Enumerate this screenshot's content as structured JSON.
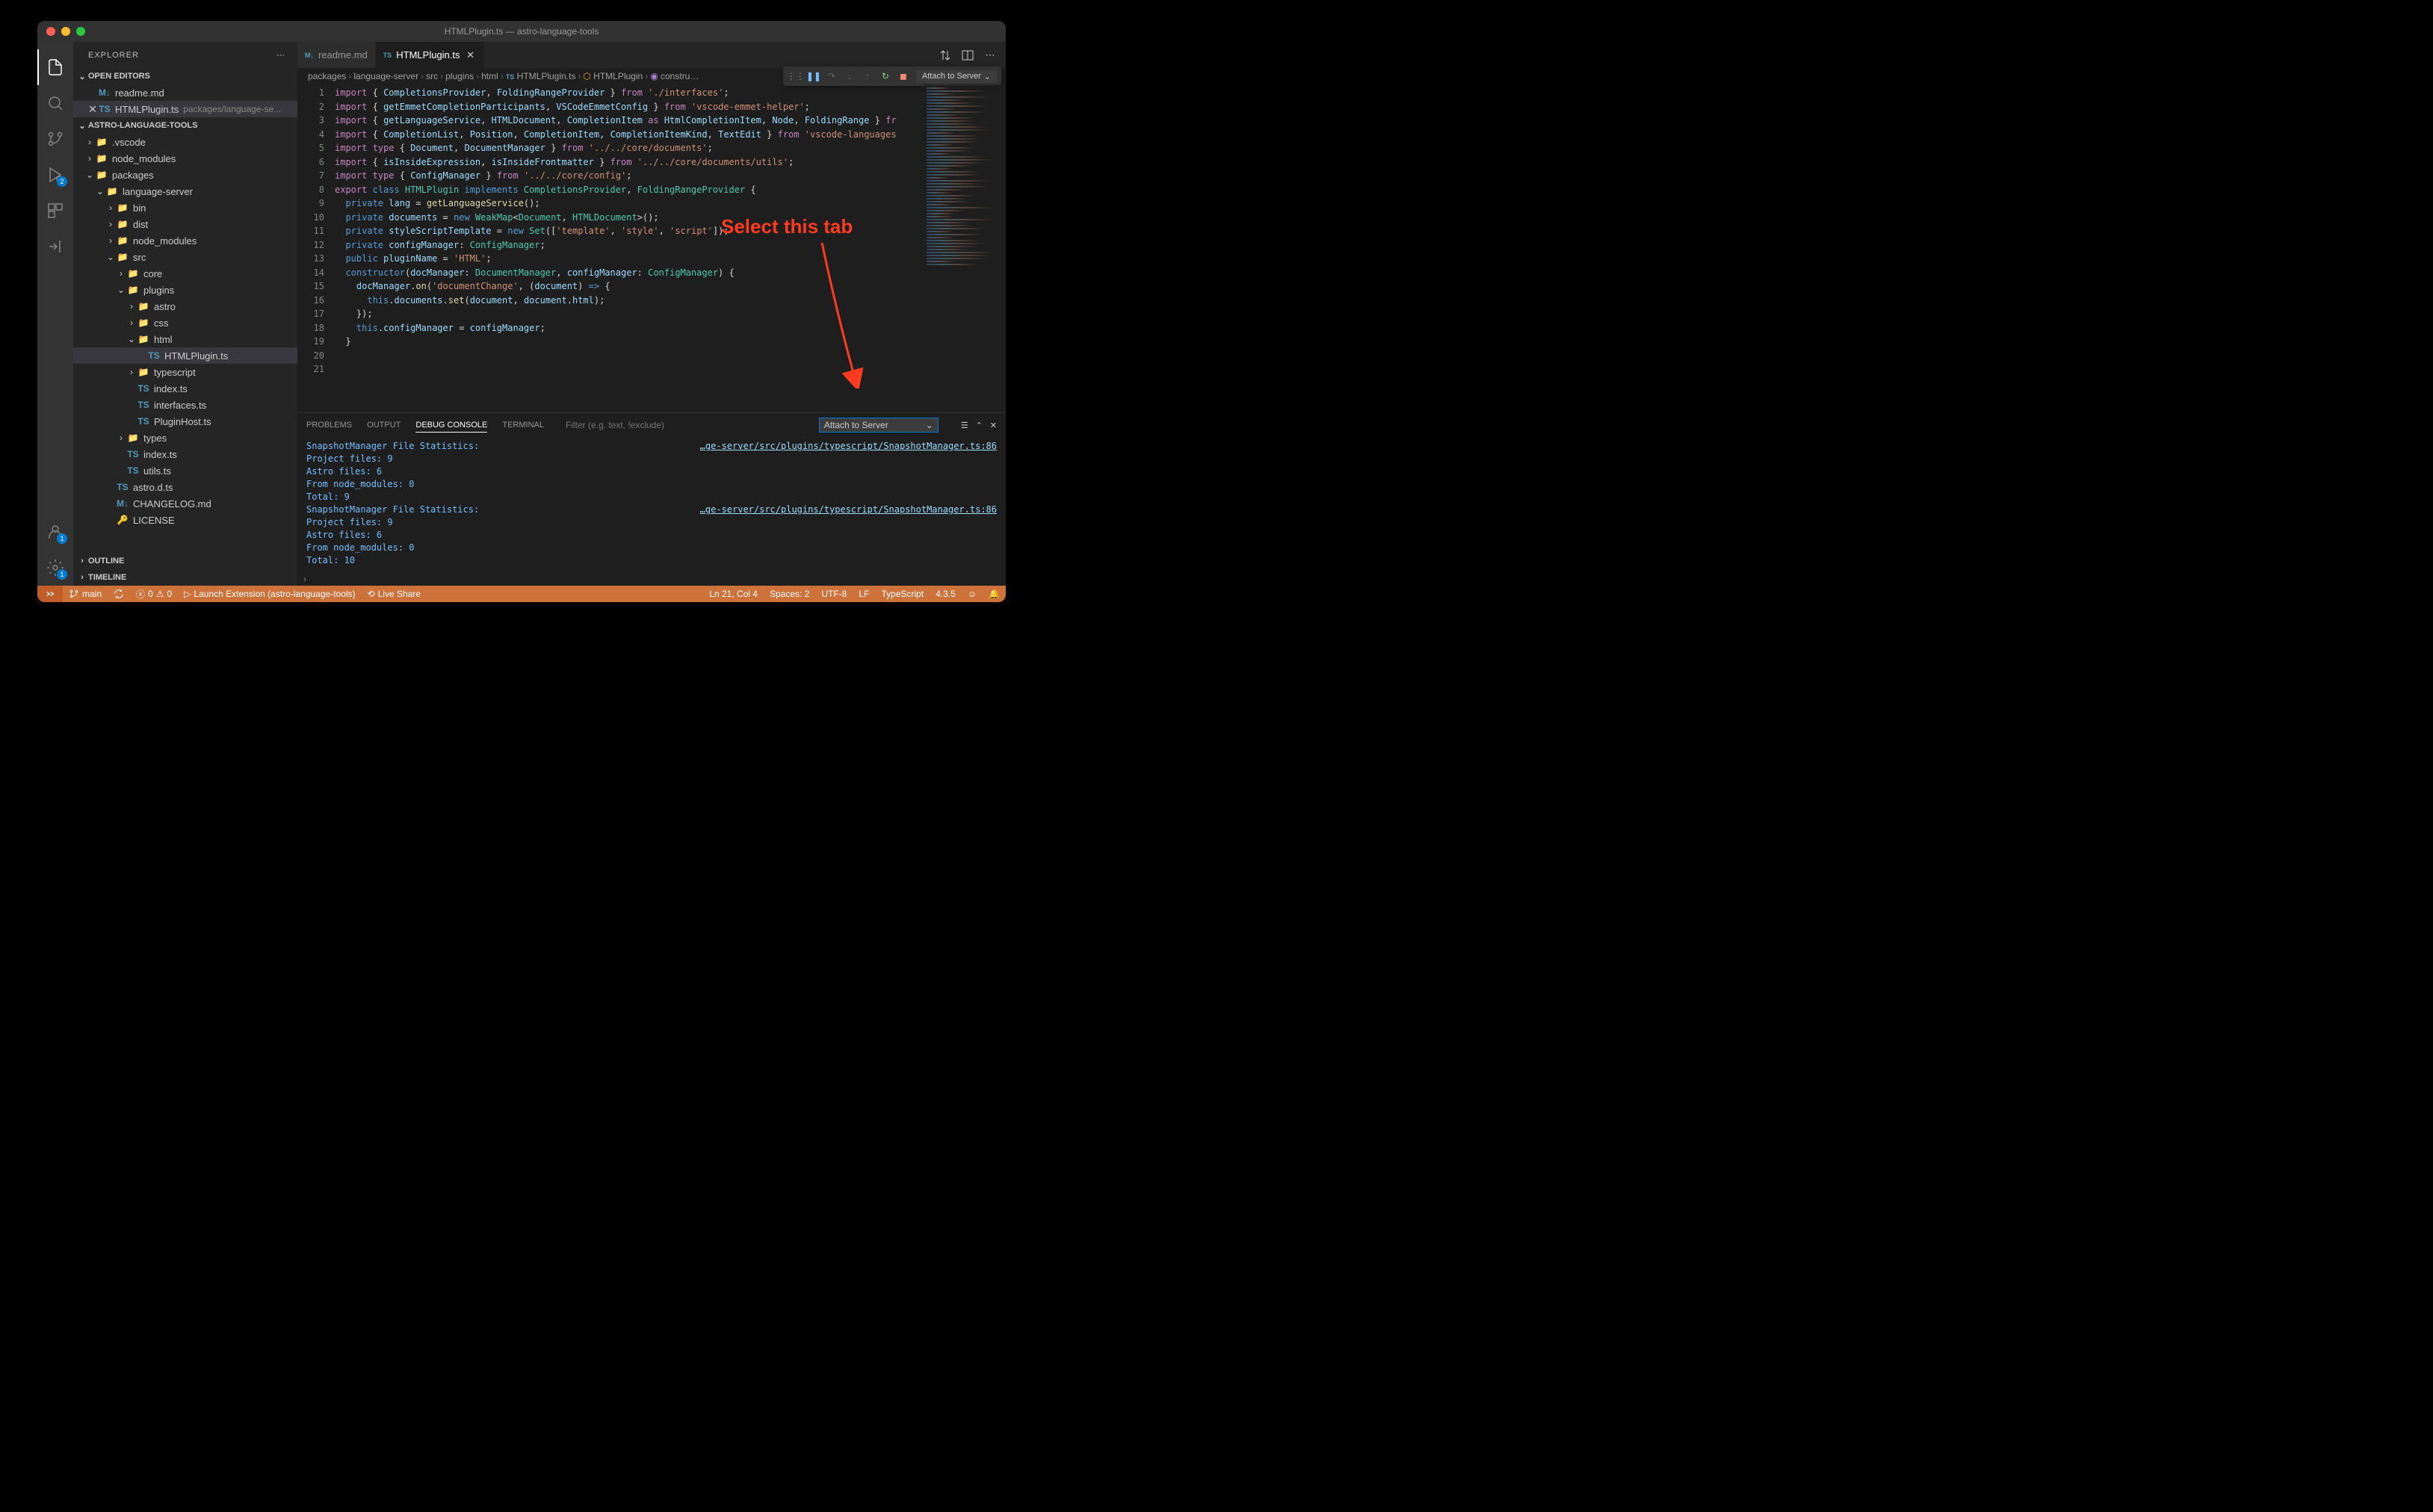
{
  "window": {
    "title": "HTMLPlugin.ts — astro-language-tools"
  },
  "sidebar": {
    "title": "EXPLORER",
    "sections": {
      "openEditors": "OPEN EDITORS",
      "workspace": "ASTRO-LANGUAGE-TOOLS",
      "outline": "OUTLINE",
      "timeline": "TIMELINE"
    },
    "openEditorItems": [
      {
        "icon": "M↓",
        "label": "readme.md",
        "closable": false
      },
      {
        "icon": "TS",
        "label": "HTMLPlugin.ts",
        "dim": "packages/language-se...",
        "closable": true,
        "selected": true
      }
    ],
    "tree": [
      {
        "d": 0,
        "chev": "›",
        "icon": "📁",
        "cls": "folder-blue",
        "label": ".vscode"
      },
      {
        "d": 0,
        "chev": "›",
        "icon": "📁",
        "cls": "folder-green",
        "label": "node_modules"
      },
      {
        "d": 0,
        "chev": "⌄",
        "icon": "📁",
        "cls": "folder-yellow",
        "label": "packages"
      },
      {
        "d": 1,
        "chev": "⌄",
        "icon": "📁",
        "cls": "folder-yellow",
        "label": "language-server"
      },
      {
        "d": 2,
        "chev": "›",
        "icon": "📁",
        "cls": "folder-red",
        "label": "bin"
      },
      {
        "d": 2,
        "chev": "›",
        "icon": "📁",
        "cls": "folder-yellow",
        "label": "dist"
      },
      {
        "d": 2,
        "chev": "›",
        "icon": "📁",
        "cls": "folder-green",
        "label": "node_modules"
      },
      {
        "d": 2,
        "chev": "⌄",
        "icon": "📁",
        "cls": "folder-green",
        "label": "src"
      },
      {
        "d": 3,
        "chev": "›",
        "icon": "📁",
        "cls": "folder-yellow",
        "label": "core"
      },
      {
        "d": 3,
        "chev": "⌄",
        "icon": "📁",
        "cls": "folder-red",
        "label": "plugins"
      },
      {
        "d": 4,
        "chev": "›",
        "icon": "📁",
        "cls": "folder-yellow",
        "label": "astro"
      },
      {
        "d": 4,
        "chev": "›",
        "icon": "📁",
        "cls": "folder-blue",
        "label": "css"
      },
      {
        "d": 4,
        "chev": "⌄",
        "icon": "📁",
        "cls": "folder-red",
        "label": "html"
      },
      {
        "d": 5,
        "chev": "",
        "icon": "TS",
        "cls": "file-ts",
        "label": "HTMLPlugin.ts",
        "selected": true
      },
      {
        "d": 4,
        "chev": "›",
        "icon": "📁",
        "cls": "folder-blue",
        "label": "typescript"
      },
      {
        "d": 4,
        "chev": "",
        "icon": "TS",
        "cls": "file-ts",
        "label": "index.ts"
      },
      {
        "d": 4,
        "chev": "",
        "icon": "TS",
        "cls": "file-ts",
        "label": "interfaces.ts"
      },
      {
        "d": 4,
        "chev": "",
        "icon": "TS",
        "cls": "file-ts",
        "label": "PluginHost.ts"
      },
      {
        "d": 3,
        "chev": "›",
        "icon": "📁",
        "cls": "folder-yellow",
        "label": "types"
      },
      {
        "d": 3,
        "chev": "",
        "icon": "TS",
        "cls": "file-ts",
        "label": "index.ts"
      },
      {
        "d": 3,
        "chev": "",
        "icon": "TS",
        "cls": "file-ts",
        "label": "utils.ts"
      },
      {
        "d": 2,
        "chev": "",
        "icon": "TS",
        "cls": "file-ts",
        "label": "astro.d.ts"
      },
      {
        "d": 2,
        "chev": "",
        "icon": "M↓",
        "cls": "file-md",
        "label": "CHANGELOG.md"
      },
      {
        "d": 2,
        "chev": "",
        "icon": "🔑",
        "cls": "",
        "label": "LICENSE"
      }
    ]
  },
  "activityBadges": {
    "debug": "2",
    "settings": "1",
    "accounts": "1"
  },
  "tabs": [
    {
      "icon": "M↓",
      "label": "readme.md",
      "active": false
    },
    {
      "icon": "TS",
      "label": "HTMLPlugin.ts",
      "active": true
    }
  ],
  "breadcrumb": [
    "packages",
    "language-server",
    "src",
    "plugins",
    "html",
    "HTMLPlugin.ts",
    "HTMLPlugin",
    "constru…"
  ],
  "debugToolbar": {
    "attach": "Attach to Server"
  },
  "code": {
    "lines": [
      1,
      2,
      3,
      4,
      5,
      6,
      7,
      8,
      9,
      10,
      11,
      12,
      13,
      14,
      15,
      16,
      17,
      18,
      19,
      20,
      21
    ],
    "content": [
      "<span class='kw'>import</span> <span class='pn'>{</span> <span class='vr'>CompletionsProvider</span><span class='pn'>,</span> <span class='vr'>FoldingRangeProvider</span> <span class='pn'>}</span> <span class='kw'>from</span> <span class='str'>'./interfaces'</span><span class='pn'>;</span>",
      "<span class='kw'>import</span> <span class='pn'>{</span> <span class='vr'>getEmmetCompletionParticipants</span><span class='pn'>,</span> <span class='vr'>VSCodeEmmetConfig</span> <span class='pn'>}</span> <span class='kw'>from</span> <span class='str'>'vscode-emmet-helper'</span><span class='pn'>;</span>",
      "<span class='kw'>import</span> <span class='pn'>{</span> <span class='vr'>getLanguageService</span><span class='pn'>,</span> <span class='vr'>HTMLDocument</span><span class='pn'>,</span> <span class='vr'>CompletionItem</span> <span class='kw'>as</span> <span class='vr'>HtmlCompletionItem</span><span class='pn'>,</span> <span class='vr'>Node</span><span class='pn'>,</span> <span class='vr'>FoldingRange</span> <span class='pn'>}</span> <span class='kw'>fr</span>",
      "<span class='kw'>import</span> <span class='pn'>{</span> <span class='vr'>CompletionList</span><span class='pn'>,</span> <span class='vr'>Position</span><span class='pn'>,</span> <span class='vr'>CompletionItem</span><span class='pn'>,</span> <span class='vr'>CompletionItemKind</span><span class='pn'>,</span> <span class='vr'>TextEdit</span> <span class='pn'>}</span> <span class='kw'>from</span> <span class='str'>'vscode-languages</span>",
      "<span class='kw'>import</span> <span class='kw'>type</span> <span class='pn'>{</span> <span class='vr'>Document</span><span class='pn'>,</span> <span class='vr'>DocumentManager</span> <span class='pn'>}</span> <span class='kw'>from</span> <span class='str'>'../../core/documents'</span><span class='pn'>;</span>",
      "<span class='kw'>import</span> <span class='pn'>{</span> <span class='vr'>isInsideExpression</span><span class='pn'>,</span> <span class='vr'>isInsideFrontmatter</span> <span class='pn'>}</span> <span class='kw'>from</span> <span class='str'>'../../core/documents/utils'</span><span class='pn'>;</span>",
      "<span class='kw'>import</span> <span class='kw'>type</span> <span class='pn'>{</span> <span class='vr'>ConfigManager</span> <span class='pn'>}</span> <span class='kw'>from</span> <span class='str'>'../../core/config'</span><span class='pn'>;</span>",
      "",
      "<span class='kw'>export</span> <span class='st'>class</span> <span class='cl'>HTMLPlugin</span> <span class='st'>implements</span> <span class='cl'>CompletionsProvider</span><span class='pn'>,</span> <span class='cl'>FoldingRangeProvider</span> <span class='pn'>{</span>",
      "  <span class='st'>private</span> <span class='vr'>lang</span> <span class='pn'>=</span> <span class='fn'>getLanguageService</span><span class='pn'>();</span>",
      "  <span class='st'>private</span> <span class='vr'>documents</span> <span class='pn'>=</span> <span class='st'>new</span> <span class='cl'>WeakMap</span><span class='pn'>&lt;</span><span class='cl'>Document</span><span class='pn'>,</span> <span class='cl'>HTMLDocument</span><span class='pn'>&gt;();</span>",
      "  <span class='st'>private</span> <span class='vr'>styleScriptTemplate</span> <span class='pn'>=</span> <span class='st'>new</span> <span class='cl'>Set</span><span class='pn'>([</span><span class='str'>'template'</span><span class='pn'>,</span> <span class='str'>'style'</span><span class='pn'>,</span> <span class='str'>'script'</span><span class='pn'>]);</span>",
      "  <span class='st'>private</span> <span class='vr'>configManager</span><span class='pn'>:</span> <span class='cl'>ConfigManager</span><span class='pn'>;</span>",
      "  <span class='st'>public</span> <span class='vr'>pluginName</span> <span class='pn'>=</span> <span class='str'>'HTML'</span><span class='pn'>;</span>",
      "",
      "  <span class='st'>constructor</span><span class='pn'>(</span><span class='vr'>docManager</span><span class='pn'>:</span> <span class='cl'>DocumentManager</span><span class='pn'>,</span> <span class='vr'>configManager</span><span class='pn'>:</span> <span class='cl'>ConfigManager</span><span class='pn'>) {</span>",
      "    <span class='vr'>docManager</span><span class='pn'>.</span><span class='fn'>on</span><span class='pn'>(</span><span class='str'>'documentChange'</span><span class='pn'>, (</span><span class='vr'>document</span><span class='pn'>)</span> <span class='st'>=&gt;</span> <span class='pn'>{</span>",
      "      <span class='st'>this</span><span class='pn'>.</span><span class='vr'>documents</span><span class='pn'>.</span><span class='fn'>set</span><span class='pn'>(</span><span class='vr'>document</span><span class='pn'>,</span> <span class='vr'>document</span><span class='pn'>.</span><span class='vr'>html</span><span class='pn'>);</span>",
      "    <span class='pn'>});</span>",
      "    <span class='st'>this</span><span class='pn'>.</span><span class='vr'>configManager</span> <span class='pn'>=</span> <span class='vr'>configManager</span><span class='pn'>;</span>",
      "  <span class='pn'>}</span>"
    ]
  },
  "panel": {
    "tabs": {
      "problems": "PROBLEMS",
      "output": "OUTPUT",
      "debugConsole": "DEBUG CONSOLE",
      "terminal": "TERMINAL"
    },
    "filterPlaceholder": "Filter (e.g. text, !exclude)",
    "select": "Attach to Server",
    "body": [
      "SnapshotManager File Statistics:",
      "Project files: 9",
      "Astro files: 6",
      "From node_modules: 0",
      "Total: 9",
      "SnapshotManager File Statistics:",
      "Project files: 9",
      "Astro files: 6",
      "From node_modules: 0",
      "Total: 10"
    ],
    "srcLink": "…ge-server/src/plugins/typescript/SnapshotManager.ts:86"
  },
  "statusbar": {
    "branch": "main",
    "errors": "0",
    "warnings": "0",
    "launch": "Launch Extension (astro-language-tools)",
    "liveShare": "Live Share",
    "cursor": "Ln 21, Col 4",
    "spaces": "Spaces: 2",
    "encoding": "UTF-8",
    "eol": "LF",
    "lang": "TypeScript",
    "version": "4.3.5"
  },
  "annotation": {
    "text": "Select this tab"
  }
}
